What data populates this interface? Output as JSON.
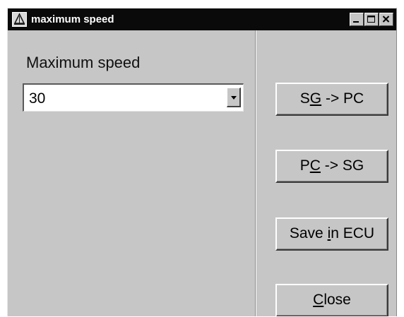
{
  "window": {
    "title": "maximum speed"
  },
  "form": {
    "label": "Maximum speed",
    "selected_value": "30"
  },
  "buttons": [
    {
      "pre": "S",
      "accel": "G",
      "post": " -> PC"
    },
    {
      "pre": "P",
      "accel": "C",
      "post": " -> SG"
    },
    {
      "pre": "Save ",
      "accel": "i",
      "post": "n ECU"
    },
    {
      "pre": "",
      "accel": "C",
      "post": "lose"
    }
  ],
  "icons": {
    "app": "app-logo-icon",
    "minimize": "minimize-icon",
    "maximize": "maximize-icon",
    "close": "close-icon",
    "dropdown": "chevron-down-icon"
  },
  "colors": {
    "titlebar": "#0a0a0a",
    "window_bg": "#c6c6c6",
    "field_bg": "#ffffff"
  }
}
